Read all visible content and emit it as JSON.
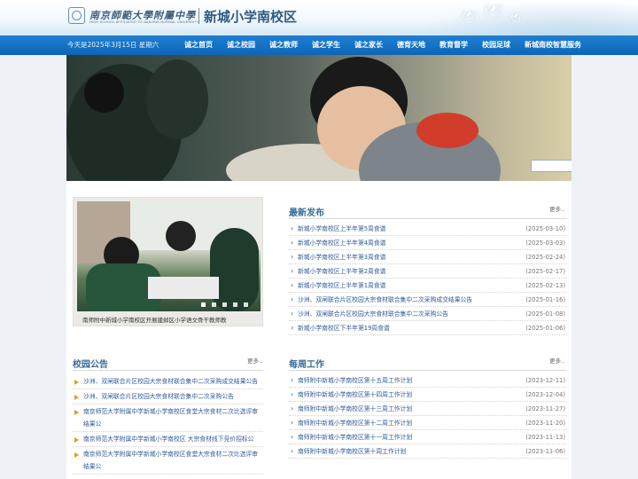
{
  "header": {
    "school_name_cn": "南京師範大學附屬中學",
    "school_name_en": "HIGH SCHOOL AFFILIATED TO NANJING NORMAL UNIVERSITY",
    "site_title": "新城小学南校区"
  },
  "nav": {
    "date": "今天是2025年3月15日 星期六",
    "items": [
      "诚之首页",
      "诚之校园",
      "诚之教师",
      "诚之学生",
      "诚之家长",
      "德育天地",
      "教育督学",
      "校园足球",
      "新城南校智慧服务"
    ]
  },
  "featured": {
    "caption": "南师附中新城小学南校区开展建邺区小学语文骨干教师教",
    "slides": 5,
    "active_slide": 1
  },
  "news": {
    "title": "最新发布",
    "more": "更多..",
    "items": [
      {
        "text": "新城小学南校区上半年第5周食谱",
        "date": "(2025-03-10)"
      },
      {
        "text": "新城小学南校区上半年第4周食谱",
        "date": "(2025-03-03)"
      },
      {
        "text": "新城小学南校区上半年第3周食谱",
        "date": "(2025-02-24)"
      },
      {
        "text": "新城小学南校区上半年第2周食谱",
        "date": "(2025-02-17)"
      },
      {
        "text": "新城小学南校区上半年第1周食谱",
        "date": "(2025-02-13)"
      },
      {
        "text": "沙洲、双闸联合片区校园大宗食材联合集中二次采购成交结果公告",
        "date": "(2025-01-16)"
      },
      {
        "text": "沙洲、双闸联合片区校园大宗食材联合集中二次采购公告",
        "date": "(2025-01-08)"
      },
      {
        "text": "新城小学南校区下半年第19周食谱",
        "date": "(2025-01-06)"
      }
    ]
  },
  "notices": {
    "title": "校园公告",
    "more": "更多..",
    "items": [
      "沙洲、双闸联合片区校园大宗食材联合集中二次采购成交结果公告",
      "沙洲、双闸联合片区校园大宗食材联合集中二次采购公告",
      "南京师范大学附属中学新城小学南校区食堂大宗食材二次比选评审结果公",
      "南京师范大学附属中学新城小学南校区 大宗食材线下竞价招标公",
      "南京师范大学附属中学新城小学南校区食堂大宗食材二次比选评审结果公"
    ]
  },
  "weekly": {
    "title": "每周工作",
    "more": "更多..",
    "items": [
      {
        "text": "南师附中新城小学南校区第十五周工作计划",
        "date": "(2023-12-11)"
      },
      {
        "text": "南师附中新城小学南校区第十四周工作计划",
        "date": "(2023-12-04)"
      },
      {
        "text": "南师附中新城小学南校区第十三周工作计划",
        "date": "(2023-11-27)"
      },
      {
        "text": "南师附中新城小学南校区第十二周工作计划",
        "date": "(2023-11-20)"
      },
      {
        "text": "南师附中新城小学南校区第十一周工作计划",
        "date": "(2023-11-13)"
      },
      {
        "text": "南师附中新城小学南校区第十周工作计划",
        "date": "(2023-11-06)"
      }
    ]
  }
}
